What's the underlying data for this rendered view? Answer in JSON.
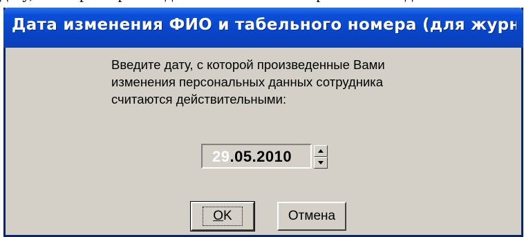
{
  "backdrop": {
    "text": "дату, с которой произведенные изменения персональных данных"
  },
  "dialog": {
    "title": "Дата изменения ФИО и табельного номера (для журн...",
    "prompt": "Введите дату, с которой произведенные Вами\nизменения персональных данных сотрудника\nсчитаются действительными:",
    "date_value": "29.05.2010",
    "date_selected_part": "29",
    "date_rest": ".05.2010",
    "ok_label_mnemonic": "O",
    "ok_label_rest": "K",
    "cancel_label": "Отмена"
  },
  "colors": {
    "titlebar": "#0b4fd8",
    "window_face": "#d4d0c8",
    "selection": "#0a246a"
  },
  "icons": {
    "spin_up": "triangle-up-icon",
    "spin_down": "triangle-down-icon"
  }
}
